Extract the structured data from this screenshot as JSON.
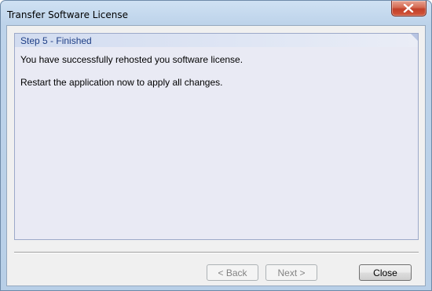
{
  "window": {
    "title": "Transfer Software License",
    "close_icon": "close-x-icon"
  },
  "step": {
    "header": "Step 5 - Finished",
    "messages": [
      "You have successfully rehosted you software license.",
      "Restart the application now to apply all changes."
    ]
  },
  "buttons": {
    "back": "< Back",
    "next": "Next >",
    "close": "Close",
    "back_enabled": false,
    "next_enabled": false,
    "close_enabled": true
  },
  "colors": {
    "header_text": "#1f3f86",
    "close_button": "#c2402a",
    "panel_bg": "#e9eaf4"
  }
}
